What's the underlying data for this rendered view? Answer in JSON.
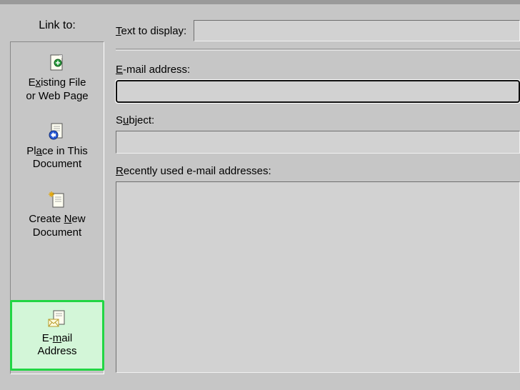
{
  "sidebar": {
    "header": "Link to:",
    "items": [
      {
        "label": "Existing File or Web Page",
        "underline_char": "x"
      },
      {
        "label": "Place in This Document",
        "underline_char": null
      },
      {
        "label": "Create New Document",
        "underline_char": "N"
      },
      {
        "label": "E-mail Address",
        "underline_char": "m"
      }
    ]
  },
  "main": {
    "text_to_display_label": "Text to display:",
    "text_to_display_underline": "T",
    "text_to_display_value": "",
    "email_label": "E-mail address:",
    "email_underline": "E",
    "email_value": "",
    "subject_label": "Subject:",
    "subject_underline": "u",
    "subject_value": "",
    "recent_label": "Recently used e-mail addresses:",
    "recent_underline": "R"
  },
  "colors": {
    "highlight_border": "#22d644",
    "highlight_fill": "#d3f6d8",
    "field_bg": "#d2d2d2",
    "dialog_bg": "#c6c6c6"
  }
}
